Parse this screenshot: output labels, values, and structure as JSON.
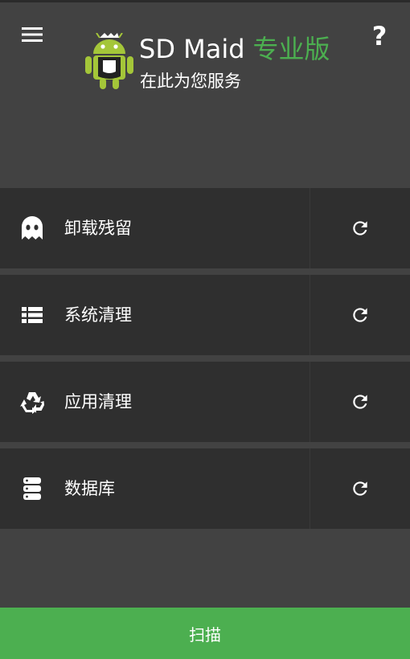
{
  "header": {
    "app_name": "SD Maid",
    "app_edition": "专业版",
    "subtitle": "在此为您服务",
    "help_label": "?",
    "menu_icon": "hamburger-menu-icon",
    "logo_icon": "android-maid-logo"
  },
  "tools": [
    {
      "label": "卸载残留",
      "icon": "ghost-icon",
      "action_icon": "refresh-icon"
    },
    {
      "label": "系统清理",
      "icon": "list-icon",
      "action_icon": "refresh-icon"
    },
    {
      "label": "应用清理",
      "icon": "recycle-icon",
      "action_icon": "refresh-icon"
    },
    {
      "label": "数据库",
      "icon": "database-icon",
      "action_icon": "refresh-icon"
    }
  ],
  "footer": {
    "scan_label": "扫描"
  },
  "colors": {
    "accent": "#4caf50",
    "background": "#424242",
    "row_background": "#2f2f2f",
    "text": "#ffffff"
  }
}
